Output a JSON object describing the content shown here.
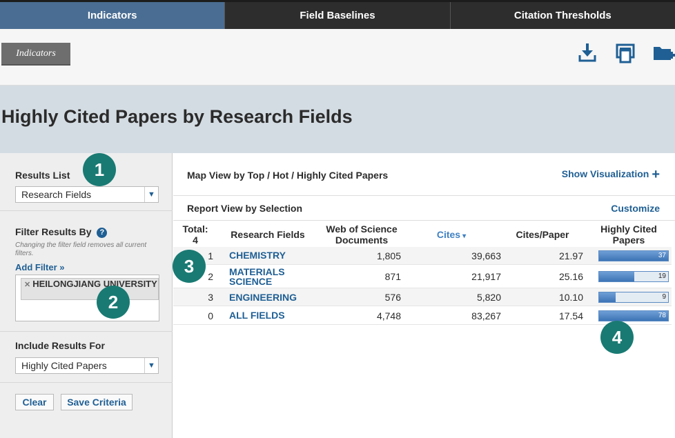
{
  "tabs": [
    {
      "label": "Indicators",
      "active": true
    },
    {
      "label": "Field Baselines",
      "active": false
    },
    {
      "label": "Citation Thresholds",
      "active": false
    }
  ],
  "breadcrumb": "Indicators",
  "header_icons": [
    "download-icon",
    "print-icon",
    "add-folder-icon"
  ],
  "page_title": "Highly Cited Papers by Research Fields",
  "left": {
    "results_list_label": "Results List",
    "results_list_value": "Research Fields",
    "filter_label": "Filter Results By",
    "filter_help": "?",
    "filter_note": "Changing the filter field removes all current filters.",
    "add_filter": "Add Filter »",
    "filter_chip": "HEILONGJIANG UNIVERSITY",
    "include_label": "Include Results For",
    "include_value": "Highly Cited Papers",
    "clear": "Clear",
    "save_criteria": "Save Criteria"
  },
  "map_title": "Map View by Top / Hot / Highly Cited Papers",
  "show_visualization": "Show Visualization",
  "report_title": "Report View by Selection",
  "customize": "Customize",
  "table": {
    "total_label": "Total:",
    "total_value": "4",
    "columns": [
      "Research Fields",
      "Web of Science Documents",
      "Cites",
      "Cites/Paper",
      "Highly Cited Papers"
    ],
    "sort_indicator": "▾",
    "rows": [
      {
        "rank": "1",
        "field": "CHEMISTRY",
        "docs": "1,805",
        "cites": "39,663",
        "cpp": "21.97",
        "hcp": "37",
        "hcp_fraction": 1.0
      },
      {
        "rank": "2",
        "field": "MATERIALS SCIENCE",
        "docs": "871",
        "cites": "21,917",
        "cpp": "25.16",
        "hcp": "19",
        "hcp_fraction": 0.51
      },
      {
        "rank": "3",
        "field": "ENGINEERING",
        "docs": "576",
        "cites": "5,820",
        "cpp": "10.10",
        "hcp": "9",
        "hcp_fraction": 0.24
      },
      {
        "rank": "0",
        "field": "ALL FIELDS",
        "docs": "4,748",
        "cites": "83,267",
        "cpp": "17.54",
        "hcp": "78",
        "hcp_fraction": 1.0
      }
    ]
  },
  "annotations": [
    "1",
    "2",
    "3",
    "4"
  ],
  "colors": {
    "tab_active": "#4a6d93",
    "link": "#1f5f94",
    "badge": "#197a73"
  }
}
